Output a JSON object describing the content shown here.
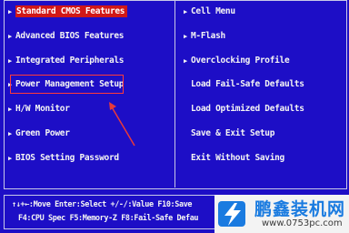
{
  "colors": {
    "background": "#1d0ec6",
    "text": "#f4f4f4",
    "selected_bg": "#d01818",
    "annotation": "#ff3a3a",
    "watermark_blue": "#1a7be0"
  },
  "left_menu": [
    {
      "label": "Standard CMOS Features",
      "has_arrow": true,
      "selected": true
    },
    {
      "label": "Advanced BIOS Features",
      "has_arrow": true,
      "selected": false
    },
    {
      "label": "Integrated Peripherals",
      "has_arrow": true,
      "selected": false
    },
    {
      "label": "Power Management Setup",
      "has_arrow": true,
      "selected": false
    },
    {
      "label": "H/W Monitor",
      "has_arrow": true,
      "selected": false
    },
    {
      "label": "Green Power",
      "has_arrow": true,
      "selected": false
    },
    {
      "label": "BIOS Setting Password",
      "has_arrow": true,
      "selected": false
    }
  ],
  "right_menu": [
    {
      "label": "Cell Menu",
      "has_arrow": true
    },
    {
      "label": "M-Flash",
      "has_arrow": true
    },
    {
      "label": "Overclocking Profile",
      "has_arrow": true
    },
    {
      "label": "Load Fail-Safe Defaults",
      "has_arrow": false
    },
    {
      "label": "Load Optimized Defaults",
      "has_arrow": false
    },
    {
      "label": "Save & Exit Setup",
      "has_arrow": false
    },
    {
      "label": "Exit Without Saving",
      "has_arrow": false
    }
  ],
  "footer": {
    "line1": "↑↓+←:Move  Enter:Select  +/-/:Value  F10:Save",
    "line2": "F4:CPU Spec  F5:Memory-Z  F8:Fail-Safe Defau"
  },
  "watermark": {
    "title": "鹏鑫装机网",
    "url": "www.0753pc.com",
    "logo_icon": "lightning-bolt-logo"
  }
}
